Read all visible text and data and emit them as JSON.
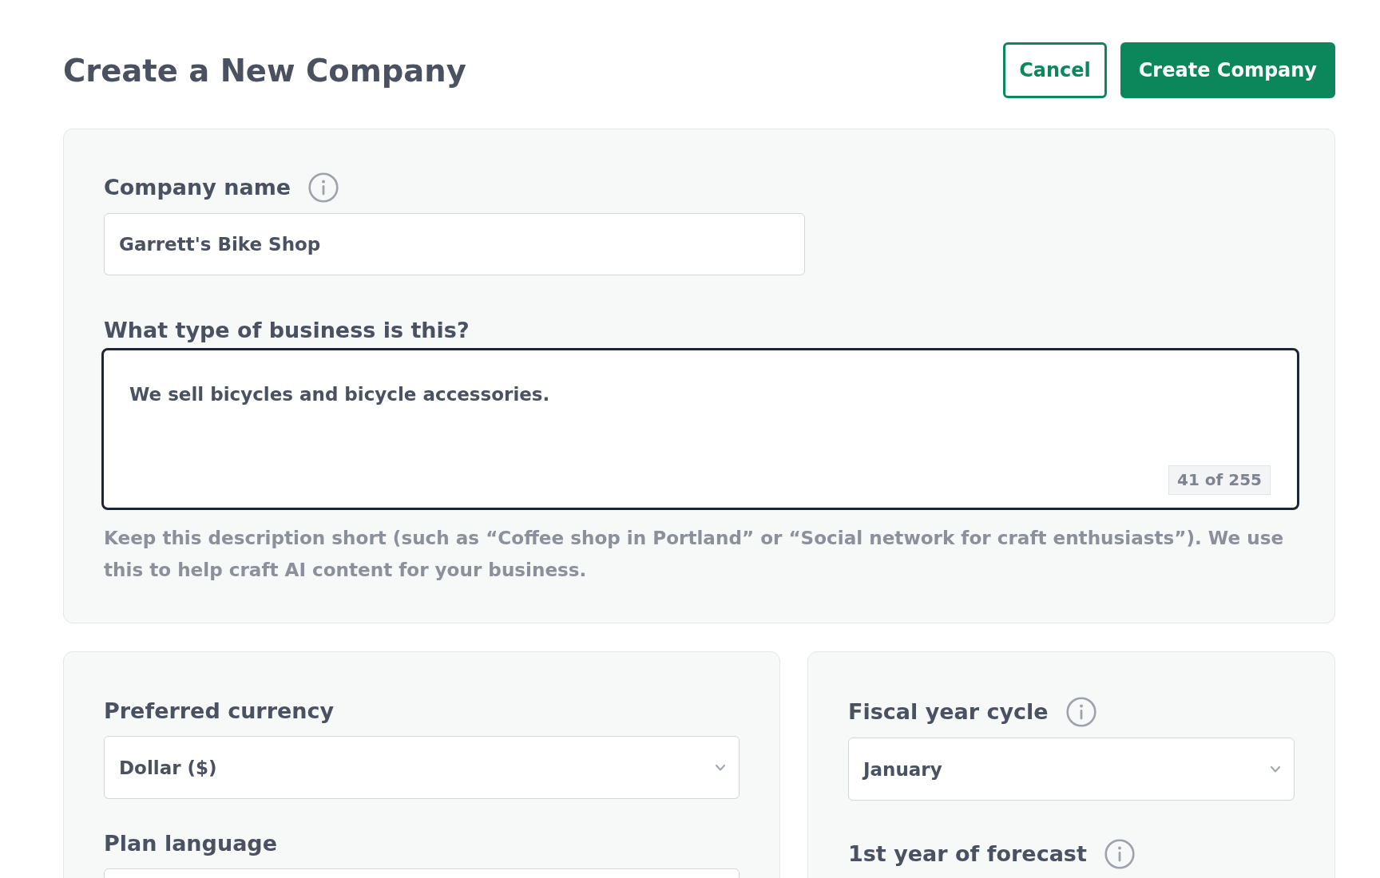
{
  "header": {
    "title": "Create a New Company",
    "buttons": [
      {
        "label": "Cancel",
        "kind": "secondary"
      },
      {
        "label": "Create Company",
        "kind": "primary"
      }
    ]
  },
  "details_card": {
    "company_name": {
      "label": "Company name",
      "info": true,
      "value": "Garrett's Bike Shop"
    },
    "business_type": {
      "label": "What type of business is this?",
      "info": false,
      "value": "We sell bicycles and bicycle accessories.",
      "focused": true,
      "counter": "41 of 255",
      "hint": "Keep this description short (such as “Coffee shop in Portland” or “Social network for craft enthusiasts”). We use this to help craft AI content for your business."
    }
  },
  "settings_cards": [
    {
      "fields": [
        {
          "label": "Preferred currency",
          "info": false,
          "kind": "select",
          "value": "Dollar ($)"
        },
        {
          "label": "Plan language",
          "info": false,
          "kind": "select"
        }
      ]
    },
    {
      "fields": [
        {
          "label": "Fiscal year cycle",
          "info": true,
          "kind": "select",
          "value": "January"
        },
        {
          "label": "1st year of forecast",
          "info": true,
          "kind": "label"
        }
      ]
    }
  ]
}
